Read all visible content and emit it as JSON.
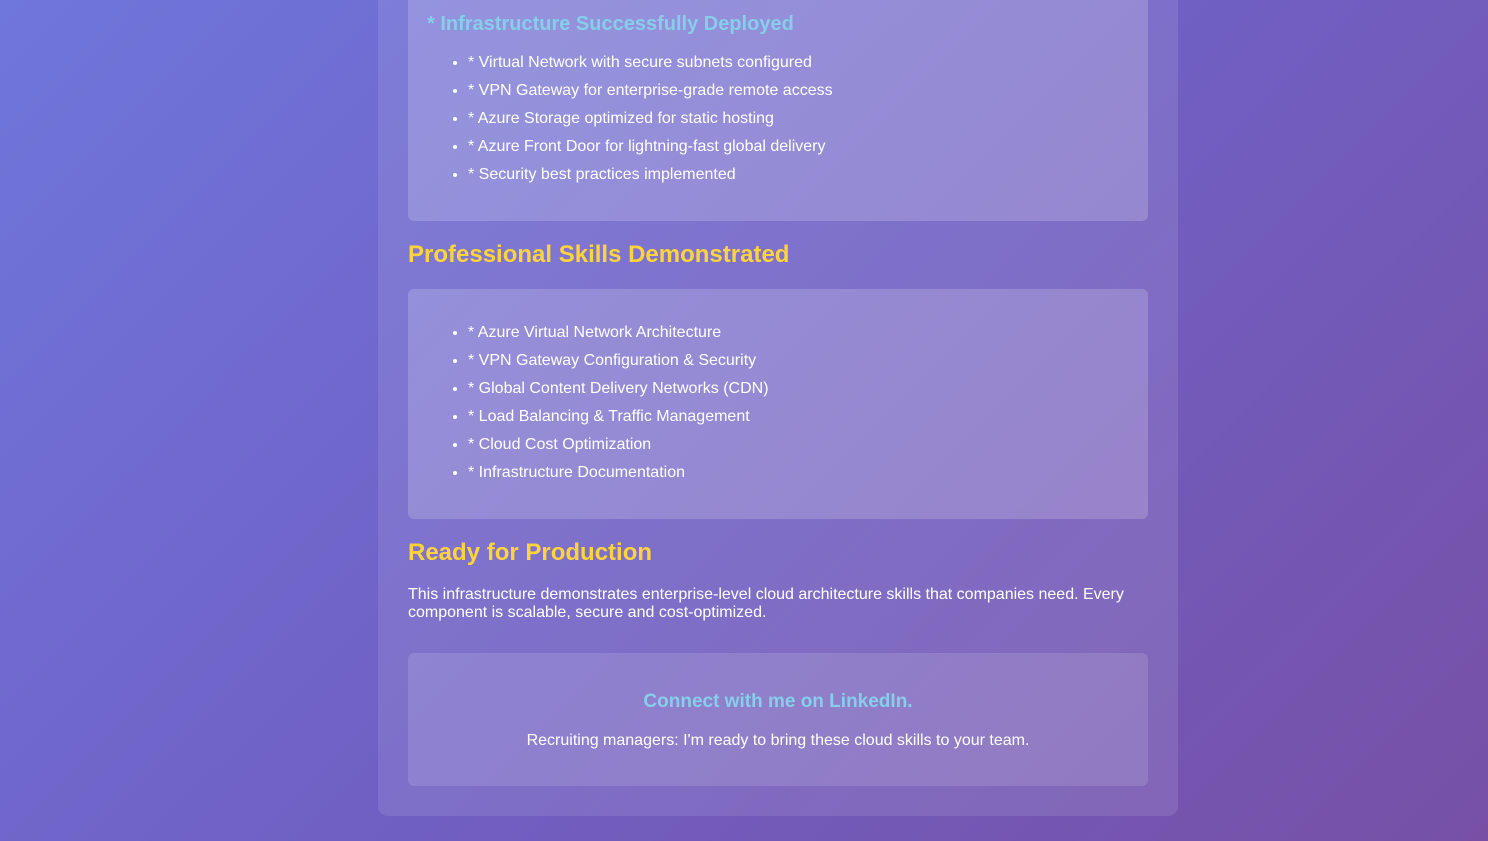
{
  "infrastructure": {
    "heading": "* Infrastructure Successfully Deployed",
    "items": [
      "* Virtual Network with secure subnets configured",
      "* VPN Gateway for enterprise-grade remote access",
      "* Azure Storage optimized for static hosting",
      "* Azure Front Door for lightning-fast global delivery",
      "* Security best practices implemented"
    ]
  },
  "skills": {
    "heading": "Professional Skills Demonstrated",
    "items": [
      "* Azure Virtual Network Architecture",
      "* VPN Gateway Configuration & Security",
      "* Global Content Delivery Networks (CDN)",
      "* Load Balancing & Traffic Management",
      "* Cloud Cost Optimization",
      "* Infrastructure Documentation"
    ]
  },
  "production": {
    "heading": "Ready for Production",
    "text": "This infrastructure demonstrates enterprise-level cloud architecture skills that companies need. Every component is scalable, secure and cost-optimized."
  },
  "connect": {
    "title": "Connect with me on LinkedIn.",
    "subtitle": "Recruiting managers: I'm ready to bring these cloud skills to your team."
  },
  "colors": {
    "accent_heading": "#ffd43b",
    "link_blue": "#87ceeb",
    "background_start": "#6f76dc",
    "background_end": "#7750a6"
  }
}
